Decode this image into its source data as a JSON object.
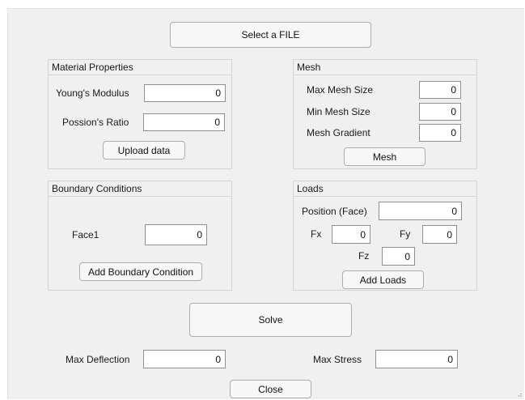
{
  "select_file_label": "Select a FILE",
  "material": {
    "title": "Material Properties",
    "youngs_label": "Young's Modulus",
    "youngs_value": "0",
    "poisson_label": "Possion's Ratio",
    "poisson_value": "0",
    "upload_label": "Upload data"
  },
  "mesh": {
    "title": "Mesh",
    "max_label": "Max Mesh Size",
    "max_value": "0",
    "min_label": "Min Mesh Size",
    "min_value": "0",
    "gradient_label": "Mesh Gradient",
    "gradient_value": "0",
    "mesh_button_label": "Mesh"
  },
  "boundary": {
    "title": "Boundary Conditions",
    "face_label": "Face1",
    "face_value": "0",
    "add_label": "Add Boundary Condition"
  },
  "loads": {
    "title": "Loads",
    "position_label": "Position (Face)",
    "position_value": "0",
    "fx_label": "Fx",
    "fx_value": "0",
    "fy_label": "Fy",
    "fy_value": "0",
    "fz_label": "Fz",
    "fz_value": "0",
    "add_label": "Add Loads"
  },
  "solve_label": "Solve",
  "results": {
    "deflection_label": "Max Deflection",
    "deflection_value": "0",
    "stress_label": "Max Stress",
    "stress_value": "0"
  },
  "close_label": "Close"
}
